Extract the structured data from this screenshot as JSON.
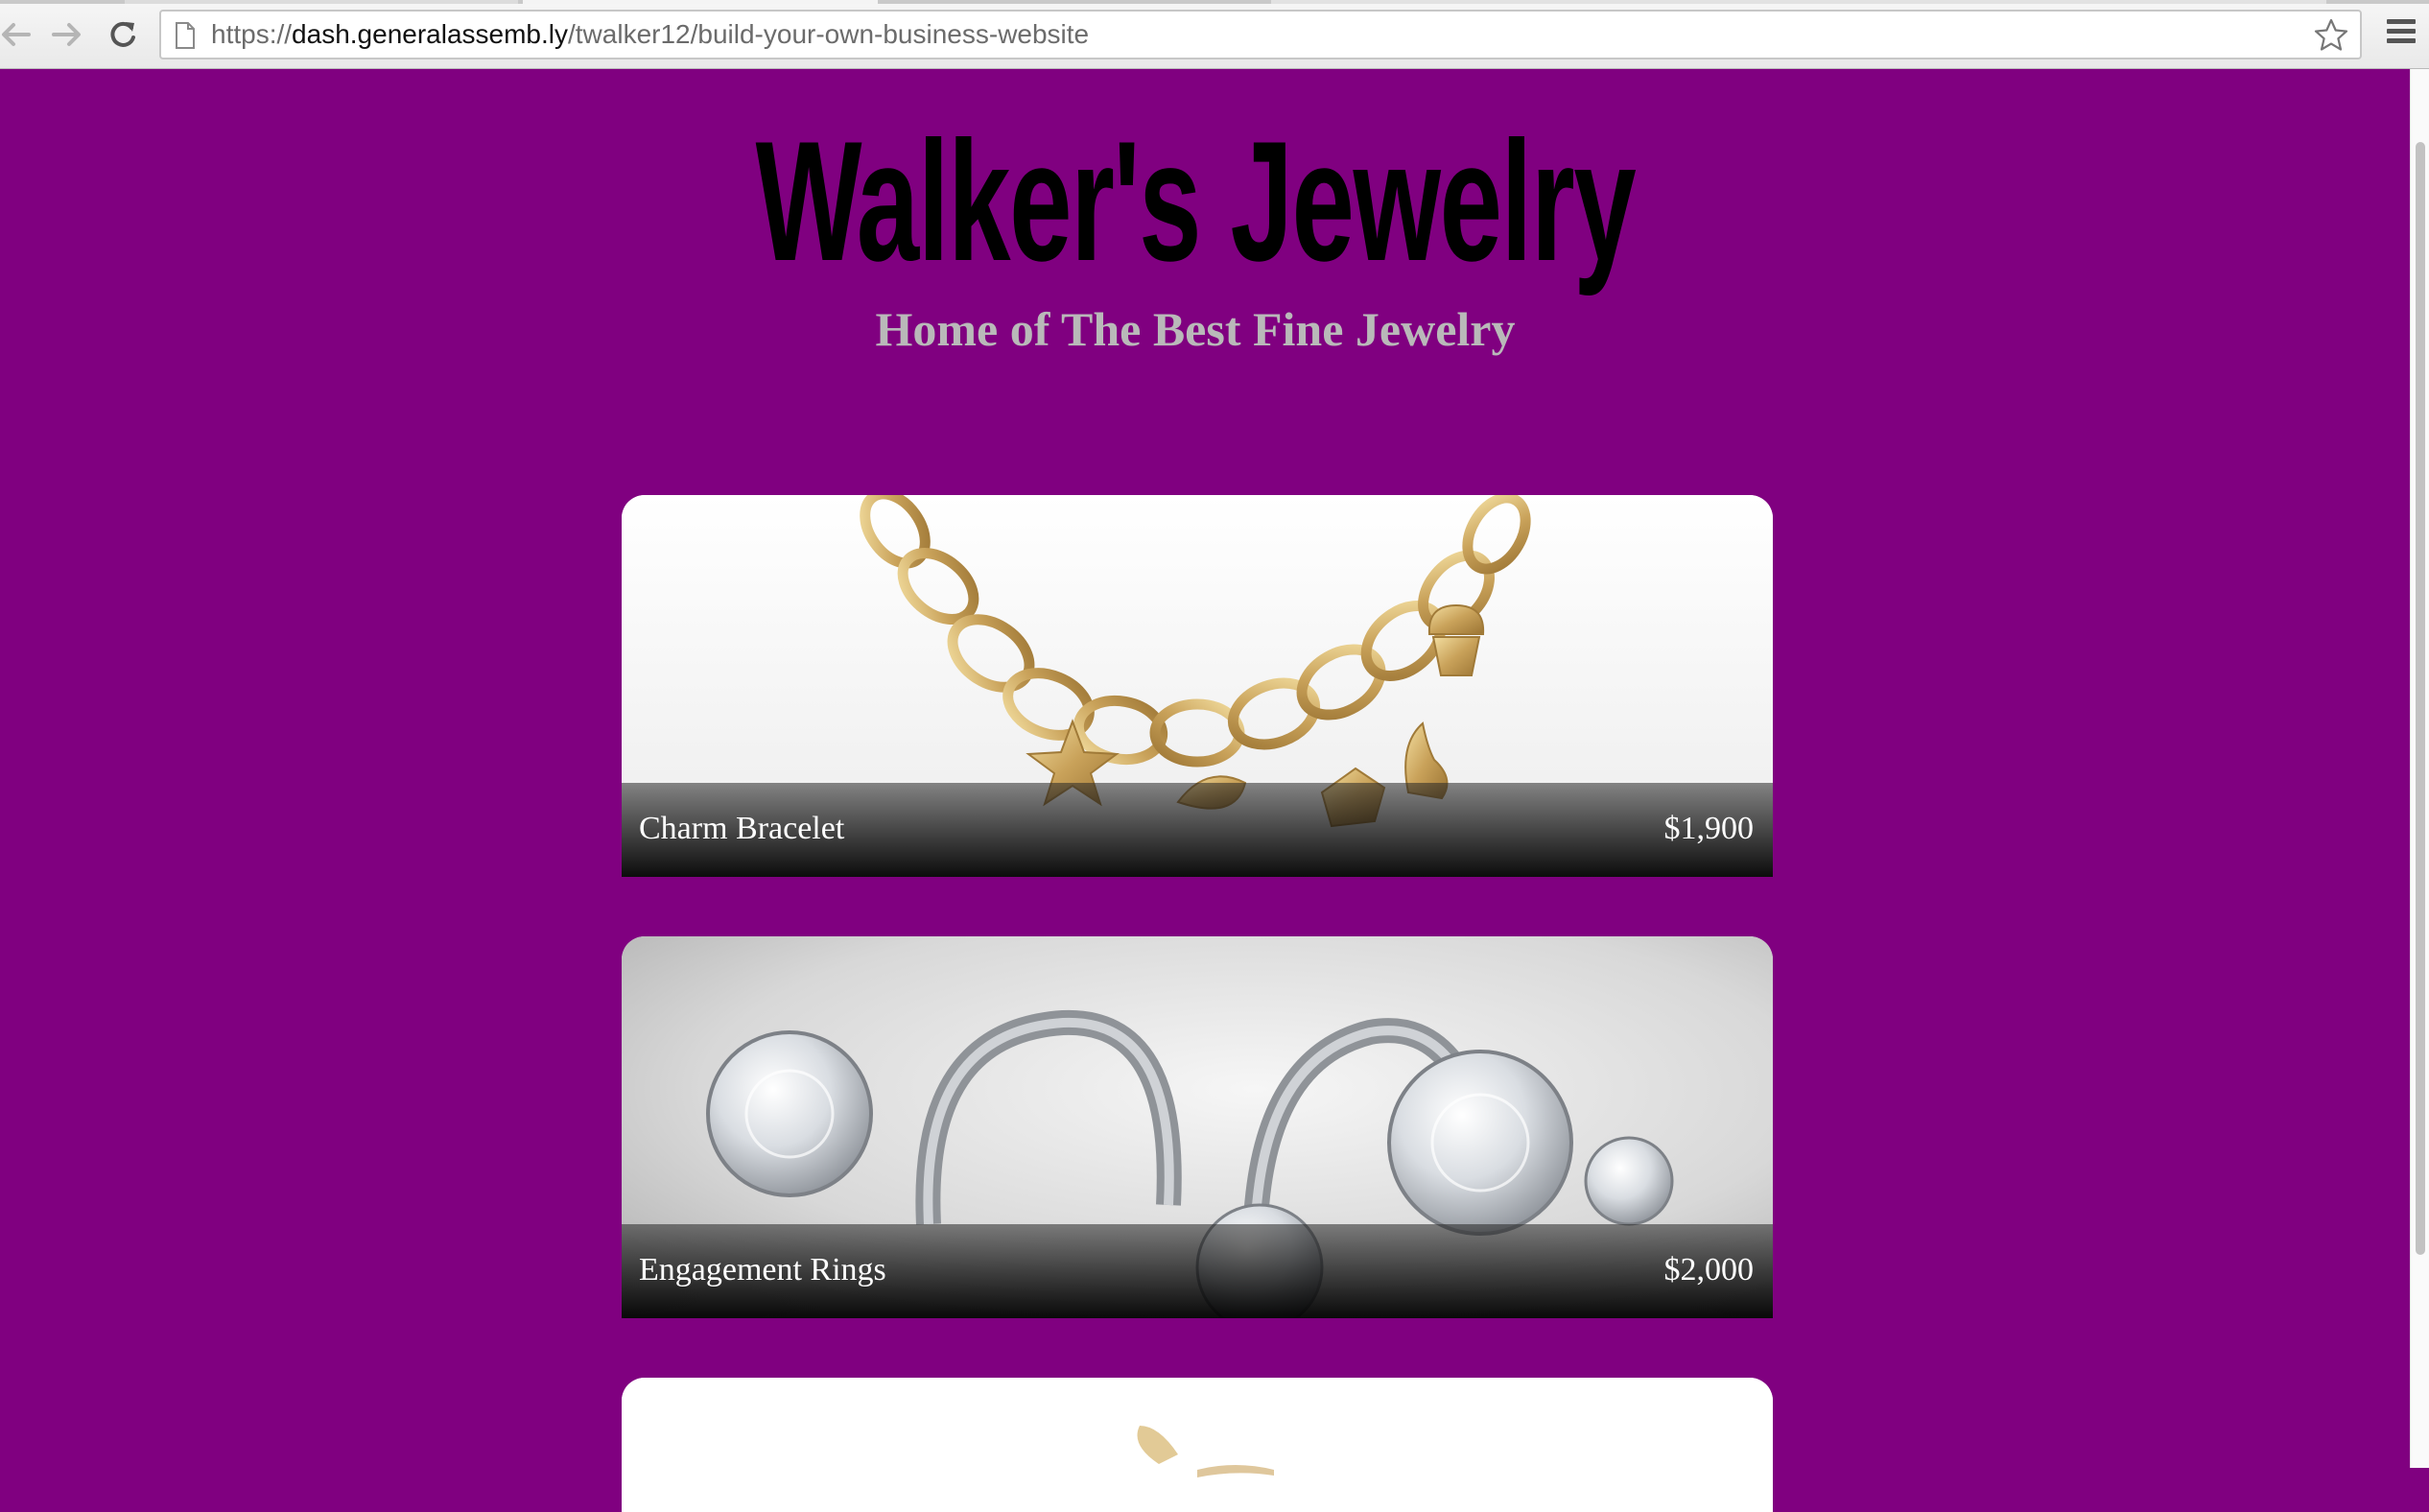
{
  "browser": {
    "url_scheme": "https://",
    "url_host": "dash.generalassemb.ly",
    "url_path": "/twalker12/build-your-own-business-website"
  },
  "site": {
    "title": "Walker's Jewelry",
    "subtitle": "Home of The Best Fine Jewelry",
    "background_color": "#800080"
  },
  "products": [
    {
      "name": "Charm Bracelet",
      "price": "$1,900"
    },
    {
      "name": "Engagement Rings",
      "price": "$2,000"
    },
    {
      "name": "",
      "price": ""
    }
  ],
  "icons": [
    "back-icon",
    "forward-icon",
    "reload-icon",
    "page-icon",
    "star-icon",
    "menu-icon"
  ]
}
